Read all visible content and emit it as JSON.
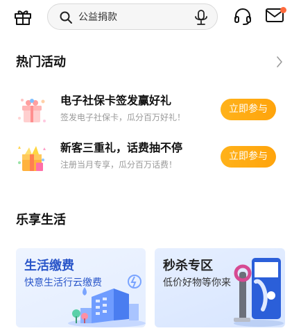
{
  "search": {
    "placeholder": "公益捐款"
  },
  "hot": {
    "title": "热门活动",
    "items": [
      {
        "title": "电子社保卡签发赢好礼",
        "subtitle": "签发电子社保卡，瓜分百万好礼！",
        "button": "立即参与"
      },
      {
        "title": "新客三重礼，话费抽不停",
        "subtitle": "注册当月专享，瓜分百万话费！",
        "button": "立即参与"
      }
    ]
  },
  "life": {
    "title": "乐享生活",
    "cards": [
      {
        "title": "生活缴费",
        "subtitle": "快意生活行云缴费"
      },
      {
        "title": "秒杀专区",
        "subtitle": "低价好物等你来"
      }
    ]
  },
  "icons": {
    "gift": "gift-icon",
    "search": "search-icon",
    "mic": "microphone-icon",
    "headset": "headset-icon",
    "mail": "mail-icon",
    "chevron": "chevron-right-icon"
  },
  "colors": {
    "accent": "#ffa40c",
    "notification_dot": "#ff6a3d",
    "card_blue": "#2a56c9"
  }
}
